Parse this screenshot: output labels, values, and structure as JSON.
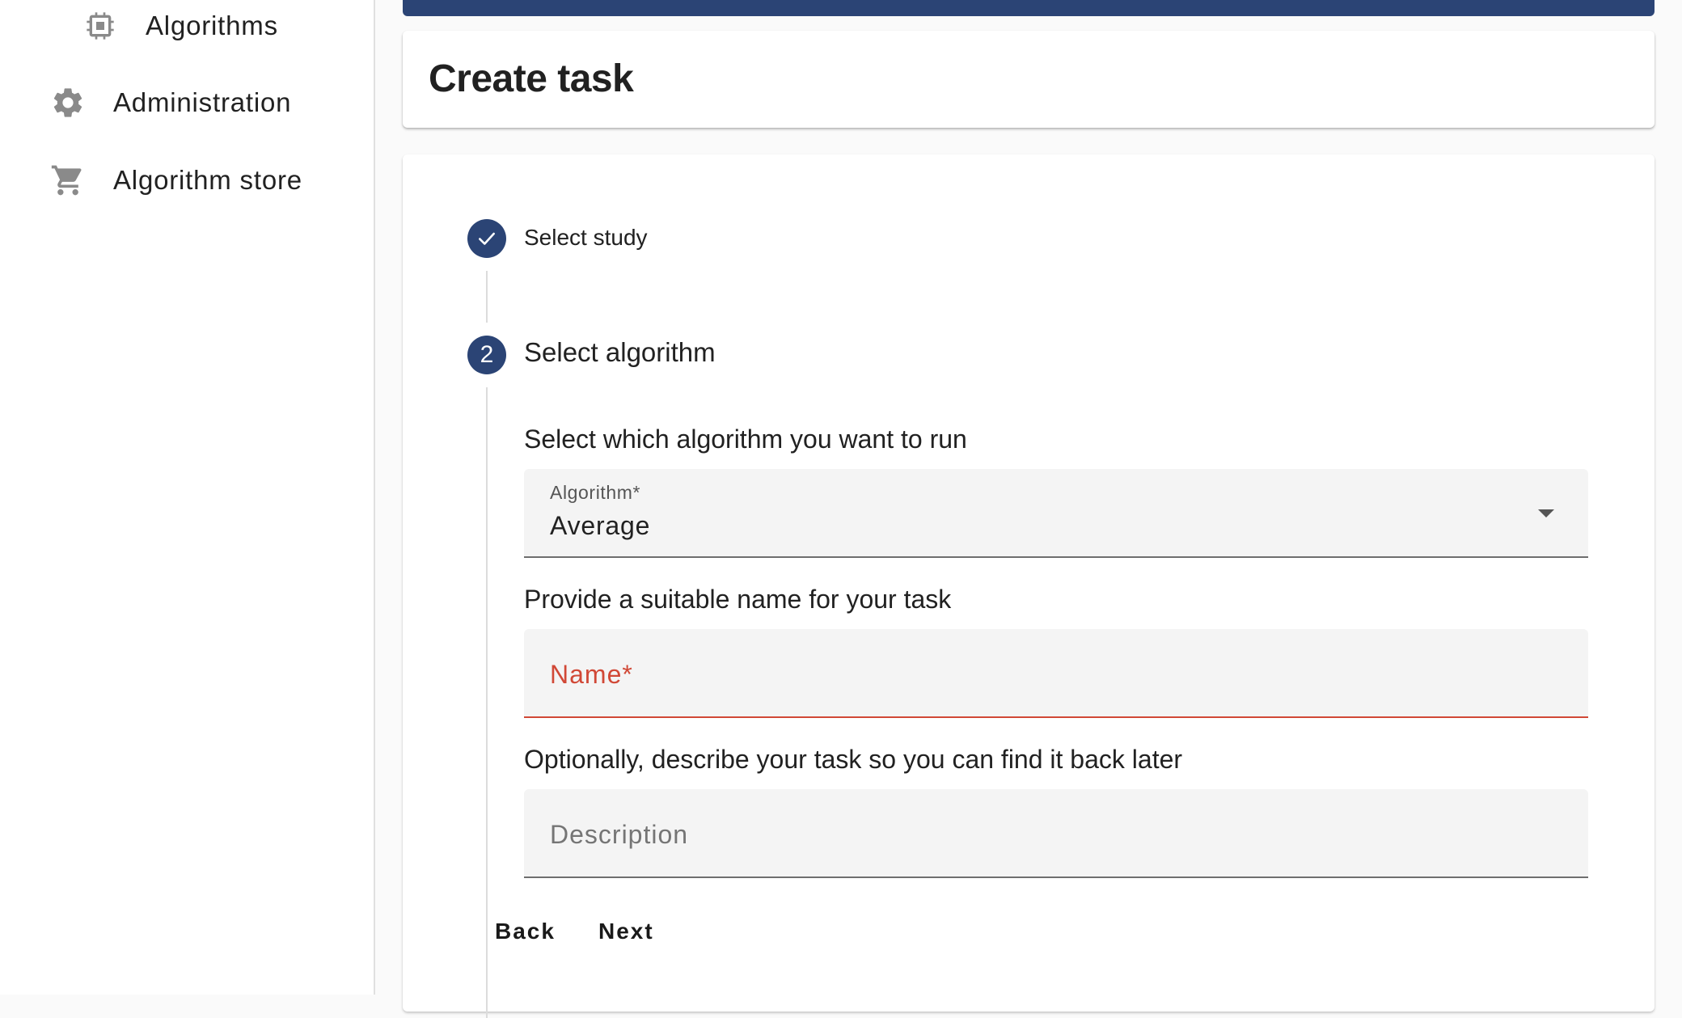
{
  "sidebar": {
    "items": [
      {
        "label": "Algorithms",
        "icon": "chip-icon"
      },
      {
        "label": "Administration",
        "icon": "gear-icon"
      },
      {
        "label": "Algorithm store",
        "icon": "cart-icon"
      }
    ]
  },
  "page": {
    "title": "Create task"
  },
  "stepper": {
    "steps": [
      {
        "label": "Select study",
        "status": "completed",
        "icon": "check-icon"
      },
      {
        "label": "Select algorithm",
        "status": "active",
        "number": "2"
      }
    ]
  },
  "form": {
    "algorithm_prompt": "Select which algorithm you want to run",
    "algorithm_label": "Algorithm*",
    "algorithm_value": "Average",
    "name_prompt": "Provide a suitable name for your task",
    "name_placeholder": "Name*",
    "description_prompt": "Optionally, describe your task so you can find it back later",
    "description_placeholder": "Description"
  },
  "actions": {
    "back_label": "Back",
    "next_label": "Next"
  },
  "colors": {
    "primary": "#2b4475",
    "error": "#d14836",
    "field_bg": "#f4f4f4"
  }
}
